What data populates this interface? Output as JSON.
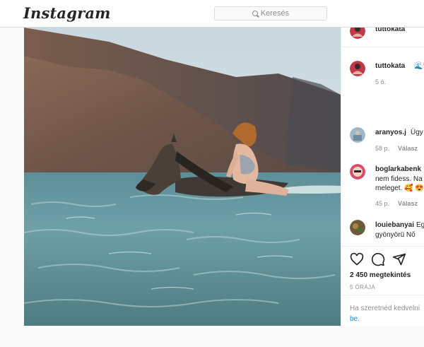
{
  "header": {
    "logo": "Instagram",
    "search_placeholder": "Keresés"
  },
  "post": {
    "author": "tuttokata",
    "caption": {
      "username": "tuttokata",
      "text": "🌊🐎",
      "time": "5 ó."
    },
    "comments": [
      {
        "username": "aranyos.j",
        "text": "Ügy",
        "time": "58 p.",
        "reply": "Válasz"
      },
      {
        "username": "boglarkabenk",
        "line2": "nem fidess. Na",
        "line3": "meleget. 🥰 😍",
        "time": "45 p.",
        "reply": "Válasz"
      },
      {
        "username": "louiebanyai",
        "text": "Eg",
        "line2": "gyönyörü Nő"
      }
    ],
    "likes_text": "2 450 megtekintés",
    "timestamp": "5 ÓRÁJA",
    "login_prompt": "Ha szeretnéd kedvelni",
    "login_link": "be."
  },
  "colors": {
    "link_blue": "#0095f6",
    "border": "#dbdbdb",
    "muted": "#8e8e8e"
  },
  "icons": [
    "search-icon",
    "heart-icon",
    "comment-icon",
    "share-icon"
  ]
}
